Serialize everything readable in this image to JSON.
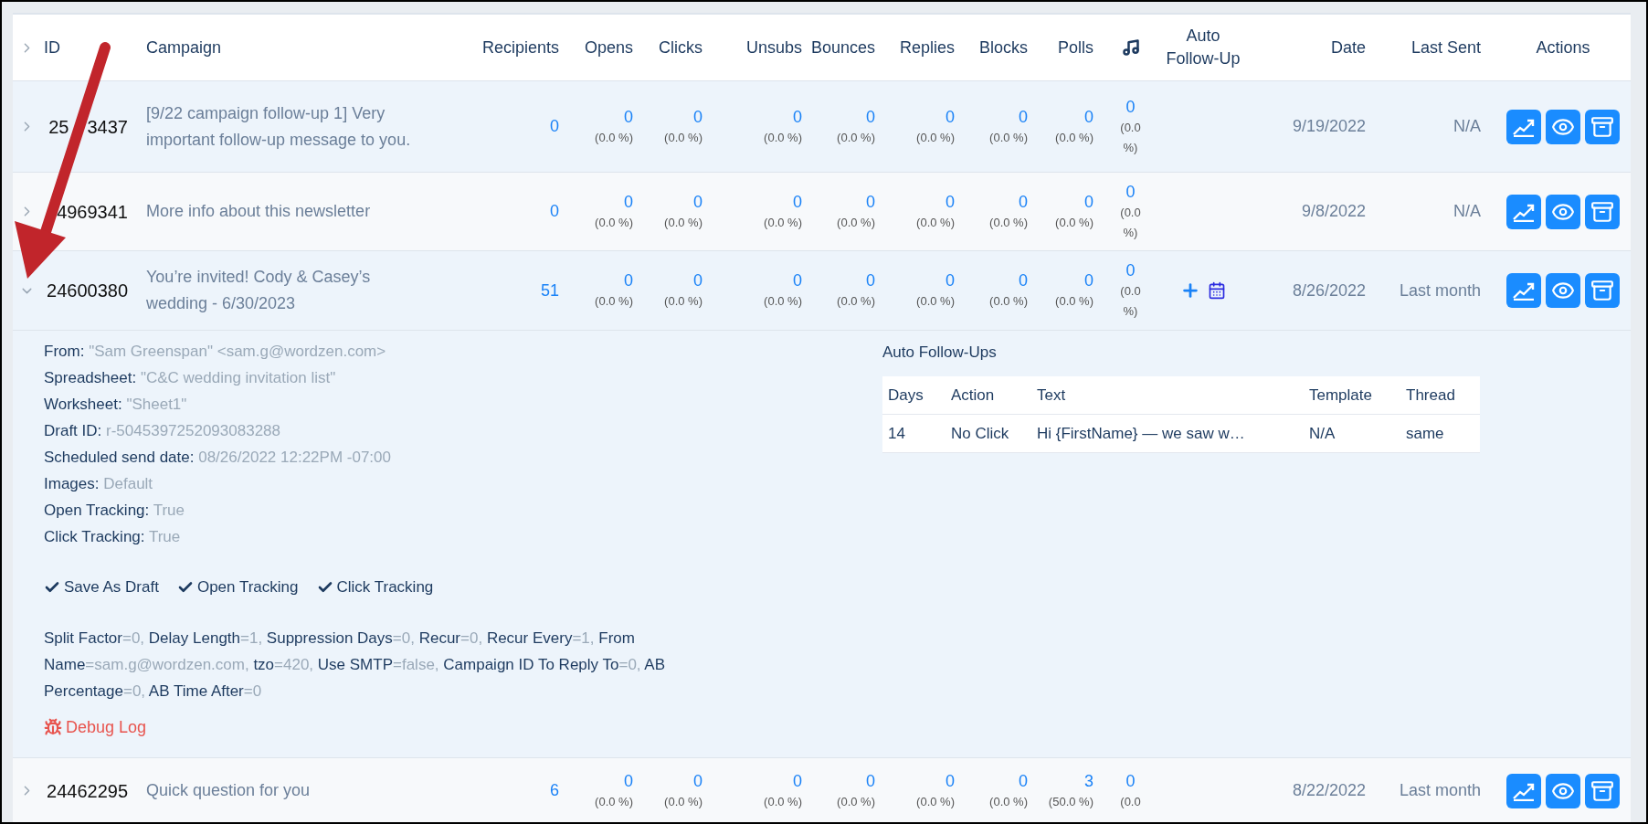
{
  "header": {
    "id": "ID",
    "campaign": "Campaign",
    "recipients": "Recipients",
    "stats": [
      "Opens",
      "Clicks",
      "Unsubs",
      "Bounces",
      "Replies",
      "Blocks",
      "Polls"
    ],
    "auto_follow_up": "Auto Follow-Up",
    "date": "Date",
    "last_sent": "Last Sent",
    "actions": "Actions"
  },
  "rows": [
    {
      "expanded": false,
      "id_parts": [
        "25",
        "3437"
      ],
      "campaign": "[9/22 campaign follow-up 1] Very important follow-up message to you.",
      "recipients": "0",
      "stats": [
        {
          "count": "0",
          "percent": "(0.0 %)"
        },
        {
          "count": "0",
          "percent": "(0.0 %)"
        },
        {
          "count": "0",
          "percent": "(0.0 %)"
        },
        {
          "count": "0",
          "percent": "(0.0 %)"
        },
        {
          "count": "0",
          "percent": "(0.0 %)"
        },
        {
          "count": "0",
          "percent": "(0.0 %)"
        },
        {
          "count": "0",
          "percent": "(0.0 %)"
        },
        {
          "count": "0",
          "percent": "(0.0 %)"
        }
      ],
      "auto_follow_up": false,
      "date": "9/19/2022",
      "last_sent": "N/A"
    },
    {
      "expanded": false,
      "id_parts": [
        "4969341"
      ],
      "campaign": "More info about this newsletter",
      "recipients": "0",
      "stats": [
        {
          "count": "0",
          "percent": "(0.0 %)"
        },
        {
          "count": "0",
          "percent": "(0.0 %)"
        },
        {
          "count": "0",
          "percent": "(0.0 %)"
        },
        {
          "count": "0",
          "percent": "(0.0 %)"
        },
        {
          "count": "0",
          "percent": "(0.0 %)"
        },
        {
          "count": "0",
          "percent": "(0.0 %)"
        },
        {
          "count": "0",
          "percent": "(0.0 %)"
        },
        {
          "count": "0",
          "percent": "(0.0 %)"
        }
      ],
      "auto_follow_up": false,
      "date": "9/8/2022",
      "last_sent": "N/A"
    },
    {
      "expanded": true,
      "id_parts": [
        "24600380"
      ],
      "campaign": "You’re invited! Cody & Casey’s wedding - 6/30/2023",
      "recipients": "51",
      "stats": [
        {
          "count": "0",
          "percent": "(0.0 %)"
        },
        {
          "count": "0",
          "percent": "(0.0 %)"
        },
        {
          "count": "0",
          "percent": "(0.0 %)"
        },
        {
          "count": "0",
          "percent": "(0.0 %)"
        },
        {
          "count": "0",
          "percent": "(0.0 %)"
        },
        {
          "count": "0",
          "percent": "(0.0 %)"
        },
        {
          "count": "0",
          "percent": "(0.0 %)"
        },
        {
          "count": "0",
          "percent": "(0.0 %)"
        }
      ],
      "auto_follow_up": true,
      "date": "8/26/2022",
      "last_sent": "Last month",
      "details": {
        "fields": [
          {
            "label": "From:",
            "value": "\"Sam Greenspan\" <sam.g@wordzen.com>"
          },
          {
            "label": "Spreadsheet:",
            "value": "\"C&C wedding invitation list\""
          },
          {
            "label": "Worksheet:",
            "value": "\"Sheet1\""
          },
          {
            "label": "Draft ID:",
            "value": "r-5045397252093083288"
          },
          {
            "label": "Scheduled send date:",
            "value": "08/26/2022 12:22PM -07:00"
          },
          {
            "label": "Images:",
            "value": "Default"
          },
          {
            "label": "Open Tracking:",
            "value": "True"
          },
          {
            "label": "Click Tracking:",
            "value": "True"
          }
        ],
        "flags": [
          {
            "label": "Save As Draft",
            "checked": true
          },
          {
            "label": "Open Tracking",
            "checked": true
          },
          {
            "label": "Click Tracking",
            "checked": true
          }
        ],
        "settings": [
          {
            "key": "Split Factor",
            "value": "=0,"
          },
          {
            "key": "Delay Length",
            "value": "=1,"
          },
          {
            "key": "Suppression Days",
            "value": "=0,"
          },
          {
            "key": "Recur",
            "value": "=0,"
          },
          {
            "key": "Recur Every",
            "value": "=1,"
          },
          {
            "key": "From Name",
            "value": "=sam.g@wordzen.com,"
          },
          {
            "key": "tzo",
            "value": "=420,"
          },
          {
            "key": "Use SMTP",
            "value": "=false,"
          },
          {
            "key": "Campaign ID To Reply To",
            "value": "=0,"
          },
          {
            "key": "AB Percentage",
            "value": "=0,"
          },
          {
            "key": "AB Time After",
            "value": "=0"
          }
        ],
        "debug_log": "Debug Log",
        "auto_follow_ups": {
          "title": "Auto Follow-Ups",
          "columns": [
            "Days",
            "Action",
            "Text",
            "Template",
            "Thread"
          ],
          "rows": [
            [
              "14",
              "No Click",
              "Hi {FirstName} — we saw w…",
              "N/A",
              "same"
            ]
          ]
        }
      }
    },
    {
      "expanded": false,
      "id_parts": [
        "24462295"
      ],
      "campaign": "Quick question for you",
      "recipients": "6",
      "stats": [
        {
          "count": "0",
          "percent": "(0.0 %)"
        },
        {
          "count": "0",
          "percent": "(0.0 %)"
        },
        {
          "count": "0",
          "percent": "(0.0 %)"
        },
        {
          "count": "0",
          "percent": "(0.0 %)"
        },
        {
          "count": "0",
          "percent": "(0.0 %)"
        },
        {
          "count": "0",
          "percent": "(0.0 %)"
        },
        {
          "count": "3",
          "percent": "(50.0 %)"
        },
        {
          "count": "0",
          "percent": "(0.0"
        }
      ],
      "auto_follow_up": false,
      "date": "8/22/2022",
      "last_sent": "Last month"
    }
  ]
}
